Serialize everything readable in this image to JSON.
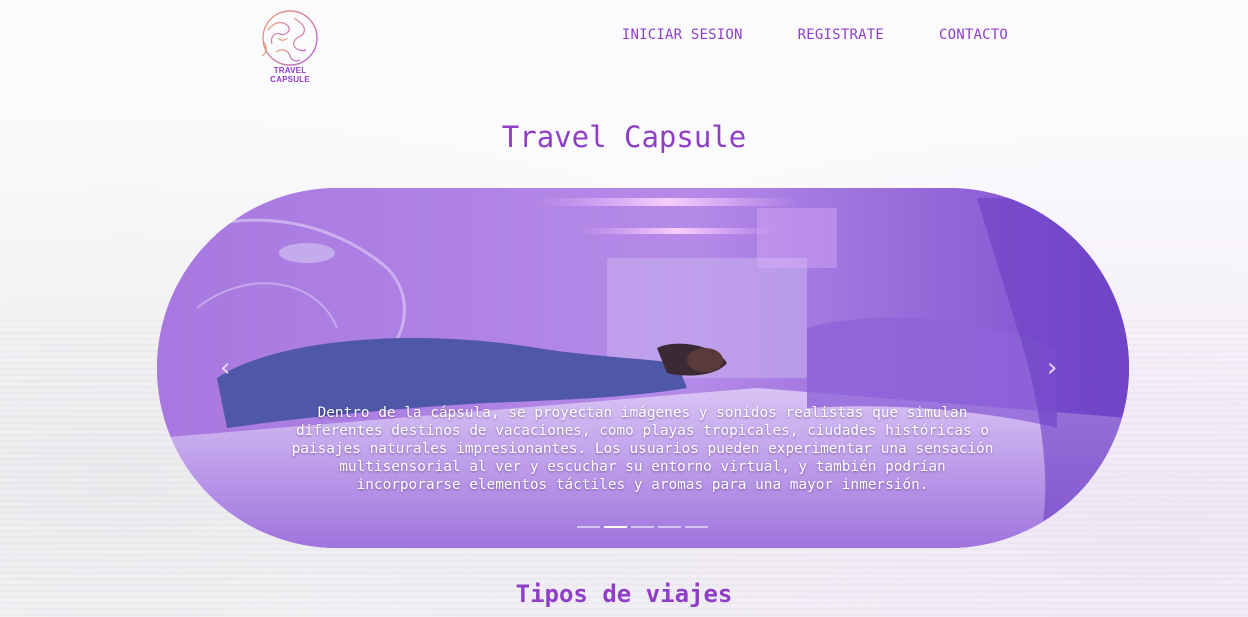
{
  "brand": {
    "logo_text": "TRAVEL CAPSULE",
    "accent_color": "#8f3fc7",
    "logo_gradient": [
      "#e3a37a",
      "#b05fd0"
    ]
  },
  "nav": {
    "items": [
      {
        "label": "INICIAR SESION"
      },
      {
        "label": "REGISTRATE"
      },
      {
        "label": "CONTACTO"
      }
    ]
  },
  "hero": {
    "title": "Travel Capsule"
  },
  "carousel": {
    "caption": "Dentro de la cápsula, se proyectan imágenes y sonidos realistas que simulan diferentes destinos de vacaciones, como playas tropicales, ciudades históricas o paisajes naturales impresionantes. Los usuarios pueden experimentar una sensación multisensorial al ver y escuchar su entorno virtual, y también podrían incorporarse elementos táctiles y aromas para una mayor inmersión.",
    "prev_icon": "chevron-left-icon",
    "next_icon": "chevron-right-icon",
    "slide_count": 5,
    "active_slide": 2
  },
  "sections": {
    "tipos_title": "Tipos de viajes"
  }
}
